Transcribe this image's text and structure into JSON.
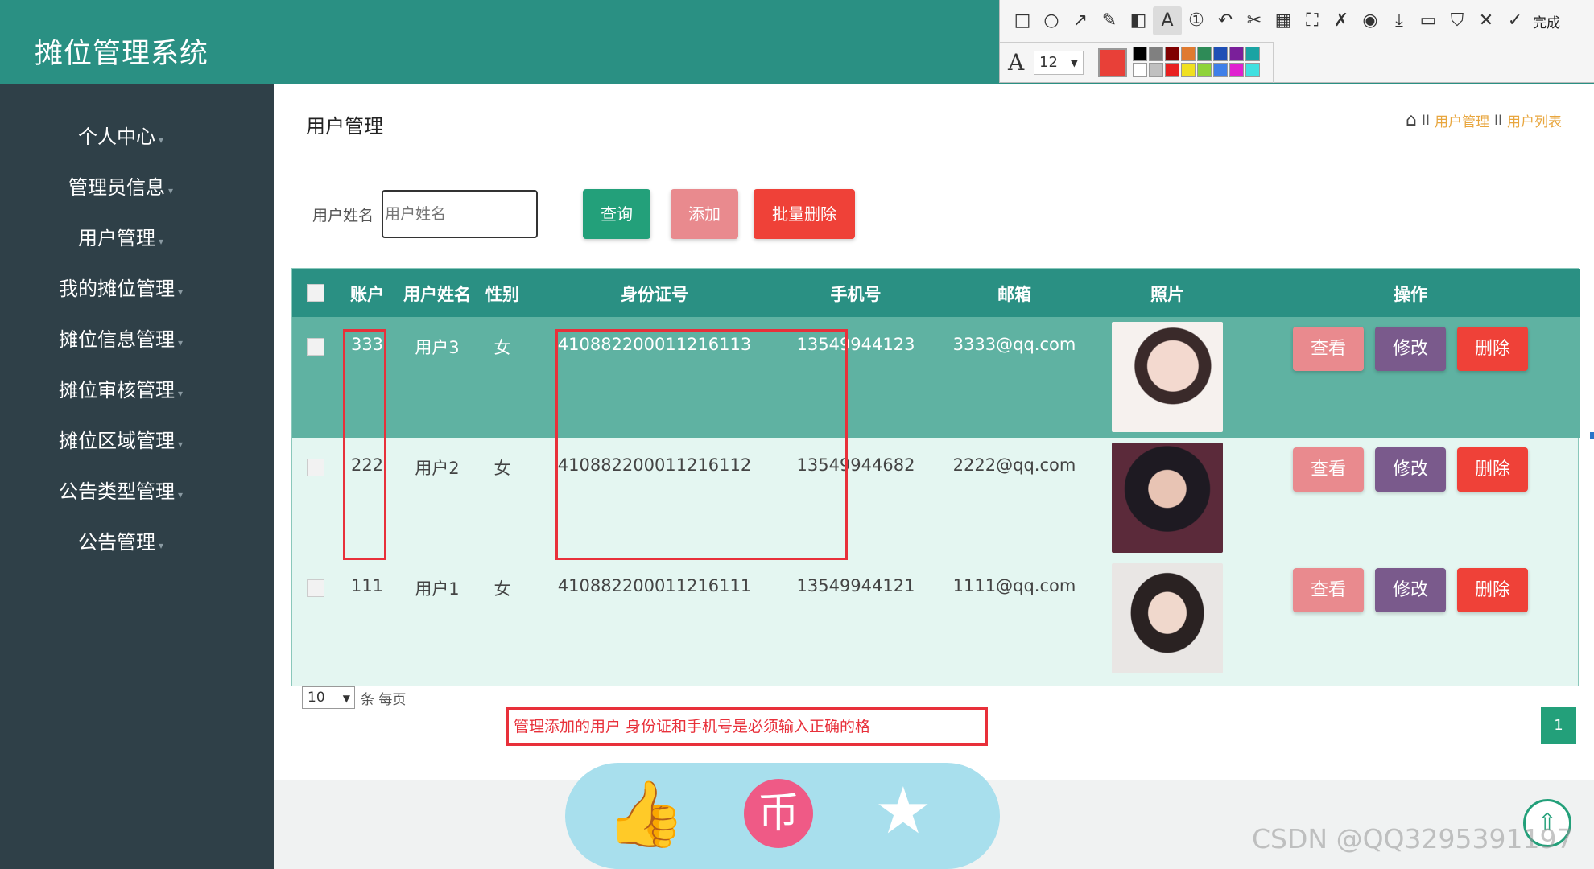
{
  "app": {
    "title": "摊位管理系统"
  },
  "header_buttons": [
    {
      "name": "fullscreen-icon",
      "symbol": "⤧"
    },
    {
      "name": "user-icon",
      "symbol": "♙"
    }
  ],
  "annotation_toolbar": {
    "tools": [
      {
        "name": "rectangle-tool-icon",
        "glyph": "□"
      },
      {
        "name": "ellipse-tool-icon",
        "glyph": "○"
      },
      {
        "name": "arrow-tool-icon",
        "glyph": "↗"
      },
      {
        "name": "pen-tool-icon",
        "glyph": "✎"
      },
      {
        "name": "mosaic-tool-icon",
        "glyph": "◧"
      },
      {
        "name": "text-tool-icon",
        "glyph": "A",
        "active": true
      },
      {
        "name": "number-tool-icon",
        "glyph": "①"
      },
      {
        "name": "undo-icon",
        "glyph": "↶"
      },
      {
        "name": "scissors-icon",
        "glyph": "✂"
      },
      {
        "name": "ocr-icon",
        "glyph": "▦"
      },
      {
        "name": "expand-icon",
        "glyph": "⛶"
      },
      {
        "name": "pin-icon",
        "glyph": "✗"
      },
      {
        "name": "record-icon",
        "glyph": "◉"
      },
      {
        "name": "download-icon",
        "glyph": "⤓"
      },
      {
        "name": "save-icon",
        "glyph": "▭"
      },
      {
        "name": "bookmark-icon",
        "glyph": "⛉"
      },
      {
        "name": "close-icon",
        "glyph": "✕"
      },
      {
        "name": "check-icon",
        "glyph": "✓"
      }
    ],
    "done_label": "完成",
    "font_label": "A",
    "font_size": "12",
    "current_color": "#e84038",
    "swatches": [
      "#000000",
      "#808080",
      "#800000",
      "#e07a30",
      "#2e8b57",
      "#1f4fb5",
      "#7a1f9a",
      "#1aa3a3",
      "#ffffff",
      "#c0c0c0",
      "#e82020",
      "#f0e020",
      "#8fd33a",
      "#3f7fe8",
      "#e020d0",
      "#40e0e0"
    ]
  },
  "sidebar": {
    "items": [
      {
        "label": "个人中心"
      },
      {
        "label": "管理员信息"
      },
      {
        "label": "用户管理"
      },
      {
        "label": "我的摊位管理"
      },
      {
        "label": "摊位信息管理"
      },
      {
        "label": "摊位审核管理"
      },
      {
        "label": "摊位区域管理"
      },
      {
        "label": "公告类型管理"
      },
      {
        "label": "公告管理"
      }
    ]
  },
  "page": {
    "title": "用户管理",
    "breadcrumb": [
      "用户管理",
      "用户列表"
    ],
    "breadcrumb_sep": "II"
  },
  "search": {
    "label": "用户姓名",
    "placeholder": "用户姓名",
    "query_label": "查询",
    "add_label": "添加",
    "batch_delete_label": "批量删除"
  },
  "table": {
    "headers": [
      "账户",
      "用户姓名",
      "性别",
      "身份证号",
      "手机号",
      "邮箱",
      "照片",
      "操作"
    ],
    "rows": [
      {
        "account": "333",
        "name": "用户3",
        "gender": "女",
        "id_number": "410882200011216113",
        "phone": "13549944123",
        "email": "3333@qq.com",
        "photo": "photo-1",
        "selected": true
      },
      {
        "account": "222",
        "name": "用户2",
        "gender": "女",
        "id_number": "410882200011216112",
        "phone": "13549944682",
        "email": "2222@qq.com",
        "photo": "photo-2",
        "selected": false
      },
      {
        "account": "111",
        "name": "用户1",
        "gender": "女",
        "id_number": "410882200011216111",
        "phone": "13549944121",
        "email": "1111@qq.com",
        "photo": "photo-3",
        "selected": false
      }
    ],
    "actions": {
      "view": "查看",
      "edit": "修改",
      "delete": "删除"
    }
  },
  "pagination": {
    "page_size": "10",
    "page_size_suffix": "条 每页",
    "current_page": "1"
  },
  "annotation_note": "管理添加的用户 身份证和手机号是必须输入正确的格",
  "watermark": "CSDN @QQ3295391197",
  "colors": {
    "header": "#2a9083",
    "sidebar": "#2f4048",
    "selected_row": "#5fb2a2",
    "row_bg": "#e4f6f1",
    "highlight": "#e8303a",
    "query": "#23a07a",
    "add": "#e98a8e",
    "edit": "#7a5a8c",
    "delete": "#ef4138"
  }
}
